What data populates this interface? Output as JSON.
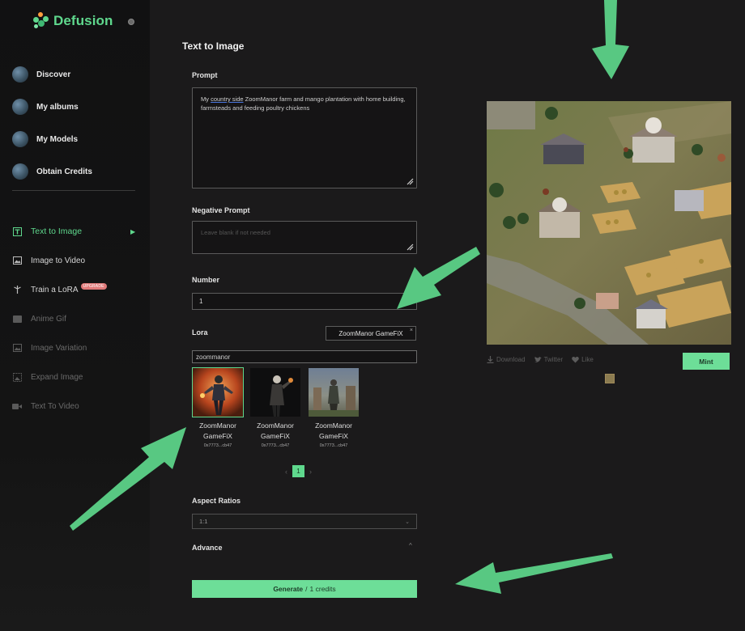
{
  "app": {
    "name": "Defusion"
  },
  "sidebar": {
    "main_items": [
      {
        "label": "Discover",
        "icon": "discover-avatar-icon"
      },
      {
        "label": "My albums",
        "icon": "albums-avatar-icon"
      },
      {
        "label": "My Models",
        "icon": "models-avatar-icon"
      },
      {
        "label": "Obtain Credits",
        "icon": "credits-avatar-icon"
      }
    ],
    "tools": [
      {
        "label": "Text to Image",
        "icon": "text-image-icon",
        "active": true
      },
      {
        "label": "Image to Video",
        "icon": "image-icon"
      },
      {
        "label": "Train a LoRA",
        "icon": "train-icon",
        "badge": "UPGRADE"
      },
      {
        "label": "Anime Gif",
        "icon": "gif-icon",
        "dim": true
      },
      {
        "label": "Image Variation",
        "icon": "image-variation-icon",
        "dim": true
      },
      {
        "label": "Expand Image",
        "icon": "expand-icon",
        "dim": true
      },
      {
        "label": "Text To Video",
        "icon": "video-icon",
        "dim": true
      }
    ],
    "accent": "#5fd88d"
  },
  "main": {
    "title": "Text to Image",
    "prompt": {
      "label": "Prompt",
      "value_start": "My ",
      "value_underlined": "country side",
      "value_rest": " ZoomManor farm and mango plantation with home building, farmsteads and feeding poultry chickens"
    },
    "negative_prompt": {
      "label": "Negative Prompt",
      "placeholder": "Leave blank if not needed"
    },
    "number": {
      "label": "Number",
      "value": "1"
    },
    "lora": {
      "label": "Lora",
      "selected_tag": "ZoomManor GameFiX",
      "search_value": "zoommanor",
      "cards": [
        {
          "name_line1": "ZoomManor",
          "name_line2": "GameFiX",
          "address": "0x7773...cb47"
        },
        {
          "name_line1": "ZoomManor",
          "name_line2": "GameFiX",
          "address": "0x7773...cb47"
        },
        {
          "name_line1": "ZoomManor",
          "name_line2": "GameFiX",
          "address": "0x7773...cb47"
        }
      ],
      "page": "1"
    },
    "aspect_ratios": {
      "label": "Aspect Ratios",
      "value": "1:1"
    },
    "advance": {
      "label": "Advance"
    },
    "generate": {
      "label": "Generate",
      "separator": "/",
      "credits": "1 credits"
    }
  },
  "preview": {
    "actions": [
      {
        "label": "Download",
        "icon": "download-icon"
      },
      {
        "label": "Twitter",
        "icon": "twitter-icon"
      },
      {
        "label": "Like",
        "icon": "heart-icon"
      }
    ],
    "mint_label": "Mint"
  }
}
